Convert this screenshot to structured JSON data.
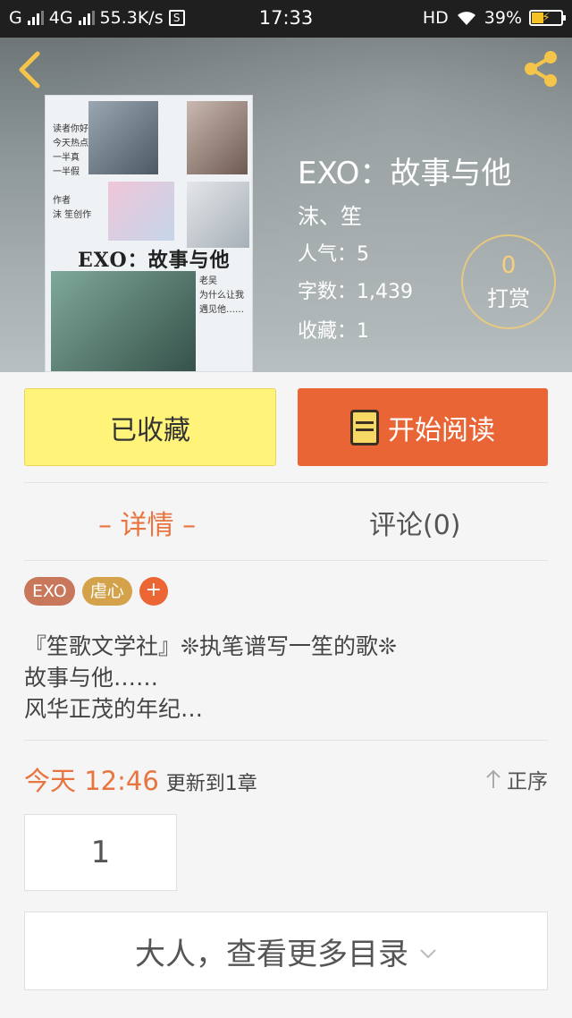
{
  "status_bar": {
    "network_left": "G",
    "network_mid": "4G",
    "speed": "55.3K/s",
    "s_badge": "S",
    "time": "17:33",
    "hd": "HD",
    "battery": "39%"
  },
  "book": {
    "title": "EXO：故事与他",
    "author": "沫、笙",
    "popularity": "人气：5",
    "word_count": "字数：1,439",
    "favorites": "收藏：1",
    "cover_title": "EXO：故事与他",
    "cover_note_left": "读者你好\n今天热点\n一半真\n一半假\n\n作者\n沫 笙创作",
    "cover_note_right": "老吴\n为什么让我\n遇见他……"
  },
  "tip": {
    "count": "0",
    "label": "打赏"
  },
  "actions": {
    "collected_label": "已收藏",
    "read_label": "开始阅读"
  },
  "tabs": {
    "detail": "– 详情 –",
    "comments": "评论(0)"
  },
  "tags": [
    "EXO",
    "虐心"
  ],
  "tag_add": "+",
  "description": {
    "line1": "『笙歌文学社』❊执笔谱写一笙的歌❊",
    "line2": "故事与他……",
    "line3": "风华正茂的年纪…"
  },
  "update": {
    "time": "今天 12:46",
    "text": "更新到1章",
    "order": "正序"
  },
  "chapter": {
    "number": "1"
  },
  "more": {
    "label": "大人，查看更多目录"
  },
  "icons": {
    "back": "chevron-left-icon",
    "share": "share-icon",
    "order": "arrow-up-icon",
    "more": "chevron-down-icon"
  },
  "colors": {
    "accent": "#ea6536",
    "tab_active": "#e8743f",
    "collect_bg": "#fff37a",
    "tip_gold": "#f7d17a"
  }
}
